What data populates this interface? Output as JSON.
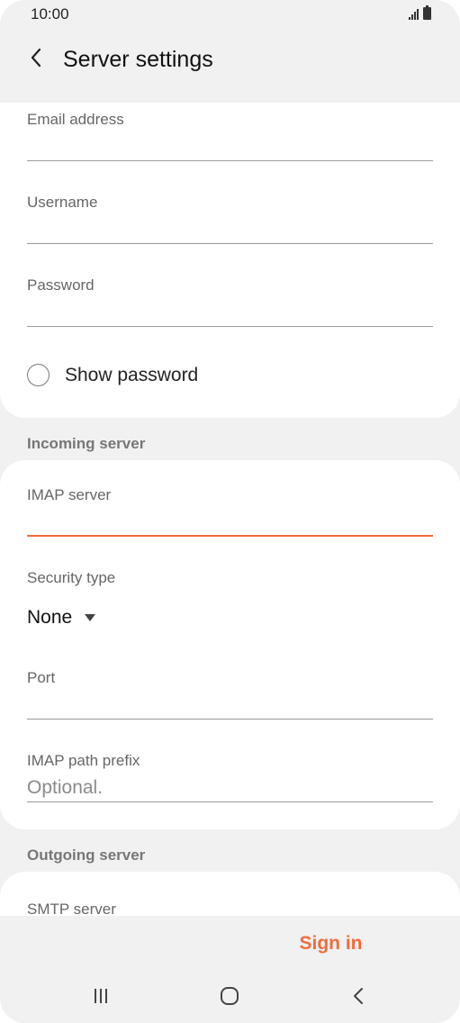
{
  "status_bar": {
    "time": "10:00",
    "signal_icon": "signal-icon",
    "battery_icon": "battery-icon"
  },
  "header": {
    "title": "Server settings",
    "back_icon": "back-arrow-icon"
  },
  "account": {
    "email_label": "Email address",
    "email_value": "",
    "username_label": "Username",
    "username_value": "",
    "password_label": "Password",
    "password_value": "",
    "show_password_label": "Show password"
  },
  "incoming": {
    "section_title": "Incoming server",
    "imap_server_label": "IMAP server",
    "imap_server_value": "",
    "security_type_label": "Security type",
    "security_type_value": "None",
    "port_label": "Port",
    "port_value": "",
    "imap_path_prefix_label": "IMAP path prefix",
    "imap_path_prefix_placeholder": "Optional."
  },
  "outgoing": {
    "section_title": "Outgoing server",
    "smtp_server_label": "SMTP server"
  },
  "actions": {
    "sign_in_label": "Sign in"
  },
  "nav": {
    "recents_icon": "recents-icon",
    "home_icon": "home-icon",
    "back_icon": "back-icon"
  },
  "colors": {
    "accent": "#f06d3d",
    "background": "#f1f1f1",
    "card": "#ffffff"
  }
}
